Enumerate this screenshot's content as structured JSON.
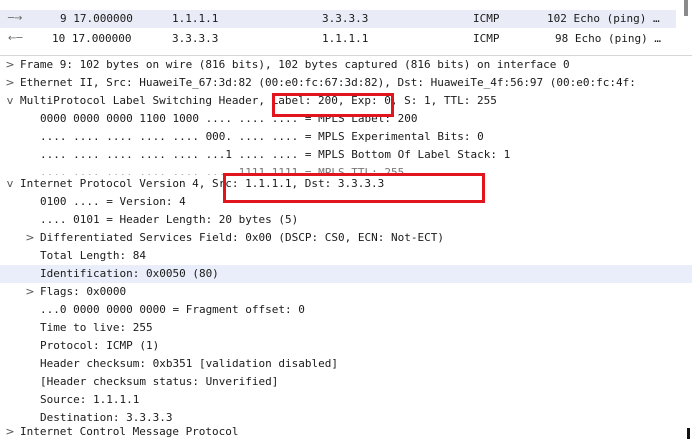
{
  "packet_list": {
    "rows": [
      {
        "no_time": "9 17.000000",
        "source": "1.1.1.1",
        "destination": "3.3.3.3",
        "protocol": "ICMP",
        "info": "102 Echo (ping) …"
      },
      {
        "no_time": "10 17.000000",
        "source": "3.3.3.3",
        "destination": "1.1.1.1",
        "protocol": "ICMP",
        "info": "98 Echo (ping) …"
      }
    ]
  },
  "details": {
    "lines": [
      {
        "arrow": ">",
        "text": "Frame 9: 102 bytes on wire (816 bits), 102 bytes captured (816 bits) on interface 0"
      },
      {
        "arrow": ">",
        "text": "Ethernet II, Src: HuaweiTe_67:3d:82 (00:e0:fc:67:3d:82), Dst: HuaweiTe_4f:56:97 (00:e0:fc:4f:"
      },
      {
        "arrow": "v",
        "text": "MultiProtocol Label Switching Header, Label: 200, Exp: 0, S: 1, TTL: 255"
      },
      {
        "arrow": "",
        "text": "0000 0000 0000 1100 1000 .... .... .... = MPLS Label: 200"
      },
      {
        "arrow": "",
        "text": ".... .... .... .... .... 000. .... .... = MPLS Experimental Bits: 0"
      },
      {
        "arrow": "",
        "text": ".... .... .... .... .... ...1 .... .... = MPLS Bottom Of Label Stack: 1"
      },
      {
        "arrow": "",
        "text": ".... .... .... .... .... .... 1111 1111 = MPLS TTL: 255"
      },
      {
        "arrow": "v",
        "text": "Internet Protocol Version 4, Src: 1.1.1.1, Dst: 3.3.3.3"
      },
      {
        "arrow": "",
        "text": "0100 .... = Version: 4"
      },
      {
        "arrow": "",
        "text": ".... 0101 = Header Length: 20 bytes (5)"
      },
      {
        "arrow": ">",
        "text": "Differentiated Services Field: 0x00 (DSCP: CS0, ECN: Not-ECT)"
      },
      {
        "arrow": "",
        "text": "Total Length: 84"
      },
      {
        "arrow": "",
        "text": "Identification: 0x0050 (80)"
      },
      {
        "arrow": ">",
        "text": "Flags: 0x0000"
      },
      {
        "arrow": "",
        "text": "...0 0000 0000 0000 = Fragment offset: 0"
      },
      {
        "arrow": "",
        "text": "Time to live: 255"
      },
      {
        "arrow": "",
        "text": "Protocol: ICMP (1)"
      },
      {
        "arrow": "",
        "text": "Header checksum: 0xb351 [validation disabled]"
      },
      {
        "arrow": "",
        "text": "[Header checksum status: Unverified]"
      },
      {
        "arrow": "",
        "text": "Source: 1.1.1.1"
      },
      {
        "arrow": "",
        "text": "Destination: 3.3.3.3"
      },
      {
        "arrow": ">",
        "text": "Internet Control Message Protocol"
      }
    ]
  },
  "colors": {
    "highlight_box": "#e2141d",
    "selected_row": "#e9ecf6"
  }
}
